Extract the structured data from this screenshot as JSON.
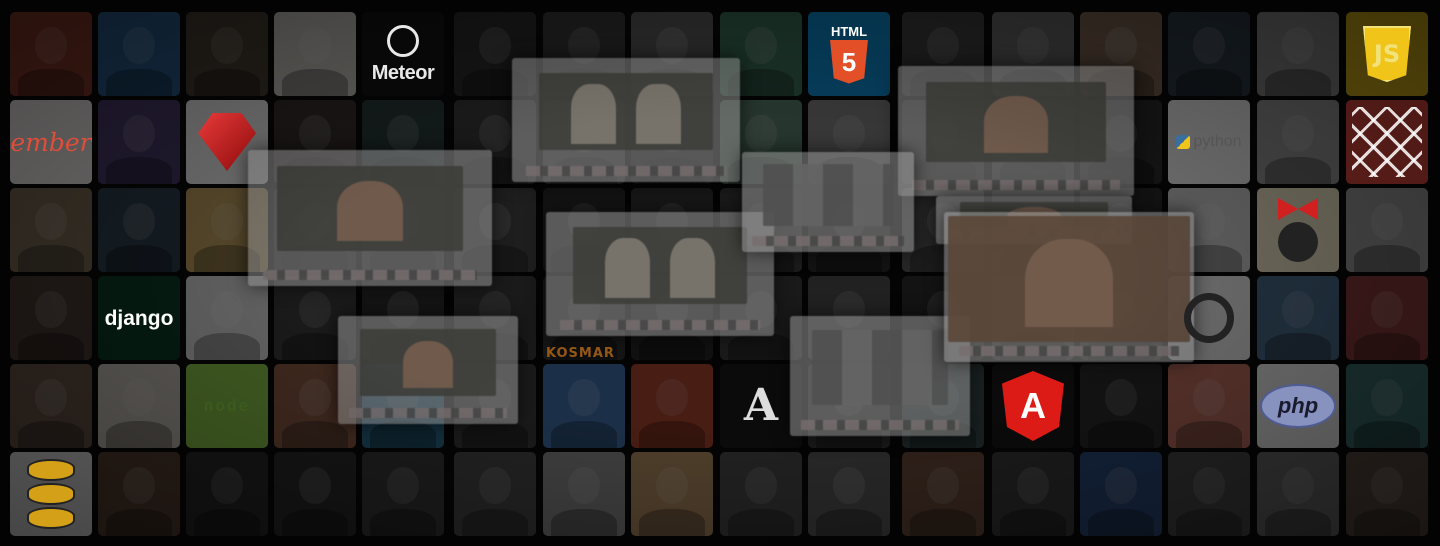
{
  "tiles": [
    {
      "r": 0,
      "c": 0,
      "type": "face",
      "bg": "#8a3a2a"
    },
    {
      "r": 0,
      "c": 1,
      "type": "face",
      "bg": "#2a5e8e"
    },
    {
      "r": 0,
      "c": 2,
      "type": "face",
      "bg": "#4a3e33"
    },
    {
      "r": 0,
      "c": 3,
      "type": "face",
      "bg": "#c9c7c2"
    },
    {
      "r": 0,
      "c": 4,
      "type": "logo",
      "bg": "#151515",
      "logo": "meteor",
      "label": "Meteor",
      "color": "#e8e8e8",
      "icon": "meteor-icon"
    },
    {
      "r": 0,
      "c": 5,
      "type": "face",
      "bg": "#2d2d2d"
    },
    {
      "r": 0,
      "c": 6,
      "type": "face",
      "bg": "#3a3a3a"
    },
    {
      "r": 0,
      "c": 7,
      "type": "face",
      "bg": "#5c5c5c"
    },
    {
      "r": 0,
      "c": 8,
      "type": "face",
      "bg": "#3b6d57"
    },
    {
      "r": 0,
      "c": 9,
      "type": "logo",
      "bg": "#0f87c9",
      "logo": "html5",
      "label": "HTML",
      "badge": "5",
      "color": "#e34f26",
      "icon": "html5-icon"
    },
    {
      "r": 0,
      "c": 10,
      "type": "face",
      "bg": "#3e3e3e"
    },
    {
      "r": 0,
      "c": 11,
      "type": "face",
      "bg": "#666666"
    },
    {
      "r": 0,
      "c": 12,
      "type": "face",
      "bg": "#7e6452"
    },
    {
      "r": 0,
      "c": 13,
      "type": "face",
      "bg": "#2f3d48"
    },
    {
      "r": 0,
      "c": 14,
      "type": "face",
      "bg": "#8a8a8a"
    },
    {
      "r": 0,
      "c": 15,
      "type": "logo",
      "bg": "#d9b31c",
      "logo": "js",
      "label": "JS",
      "color": "#f2e27a",
      "icon": "js-icon"
    },
    {
      "r": 1,
      "c": 0,
      "type": "logo",
      "bg": "#f4eeee",
      "logo": "ember",
      "label": "ember",
      "color": "#e04e39",
      "icon": "ember-icon"
    },
    {
      "r": 1,
      "c": 1,
      "type": "face",
      "bg": "#4b3a6b"
    },
    {
      "r": 1,
      "c": 2,
      "type": "logo",
      "bg": "#f1f1f1",
      "logo": "ruby",
      "label": "",
      "color": "#c61a1a",
      "icon": "ruby-icon"
    },
    {
      "r": 1,
      "c": 3,
      "type": "face",
      "bg": "#3a3030"
    },
    {
      "r": 1,
      "c": 4,
      "type": "face",
      "bg": "#2a3a3a"
    },
    {
      "r": 1,
      "c": 5,
      "type": "face",
      "bg": "#3b3b3b"
    },
    {
      "r": 1,
      "c": 6,
      "type": "face",
      "bg": "#444444"
    },
    {
      "r": 1,
      "c": 7,
      "type": "face",
      "bg": "#222222"
    },
    {
      "r": 1,
      "c": 8,
      "type": "face",
      "bg": "#557766"
    },
    {
      "r": 1,
      "c": 9,
      "type": "face",
      "bg": "#7a7a7a"
    },
    {
      "r": 1,
      "c": 10,
      "type": "face",
      "bg": "#333333"
    },
    {
      "r": 1,
      "c": 11,
      "type": "face",
      "bg": "#3d3d3d"
    },
    {
      "r": 1,
      "c": 12,
      "type": "face",
      "bg": "#2e2e2e"
    },
    {
      "r": 1,
      "c": 13,
      "type": "logo",
      "bg": "#f2f2f2",
      "logo": "python",
      "label": "python",
      "color": "#3a6e9e",
      "icon": "python-icon"
    },
    {
      "r": 1,
      "c": 14,
      "type": "face",
      "bg": "#9a9a9a"
    },
    {
      "r": 1,
      "c": 15,
      "type": "logo",
      "bg": "#e24a3f",
      "logo": "laravel",
      "label": "",
      "color": "#ffffff",
      "icon": "laravel-icon"
    },
    {
      "r": 2,
      "c": 0,
      "type": "face",
      "bg": "#7b6a55"
    },
    {
      "r": 2,
      "c": 1,
      "type": "face",
      "bg": "#2e3e4e"
    },
    {
      "r": 2,
      "c": 2,
      "type": "face",
      "bg": "#c0a060"
    },
    {
      "r": 2,
      "c": 3,
      "type": "face",
      "bg": "#2b2b2b"
    },
    {
      "r": 2,
      "c": 4,
      "type": "face",
      "bg": "#3a3a3a"
    },
    {
      "r": 2,
      "c": 5,
      "type": "face",
      "bg": "#444444"
    },
    {
      "r": 2,
      "c": 6,
      "type": "face",
      "bg": "#2a2a2a"
    },
    {
      "r": 2,
      "c": 7,
      "type": "face",
      "bg": "#333333"
    },
    {
      "r": 2,
      "c": 8,
      "type": "face",
      "bg": "#3c3c3c"
    },
    {
      "r": 2,
      "c": 9,
      "type": "face",
      "bg": "#2a2a2a"
    },
    {
      "r": 2,
      "c": 10,
      "type": "face",
      "bg": "#555555"
    },
    {
      "r": 2,
      "c": 11,
      "type": "face",
      "bg": "#3a3a3a"
    },
    {
      "r": 2,
      "c": 12,
      "type": "face",
      "bg": "#2e2e2e"
    },
    {
      "r": 2,
      "c": 13,
      "type": "face",
      "bg": "#cfcfcf"
    },
    {
      "r": 2,
      "c": 14,
      "type": "logo",
      "bg": "#f1e9c9",
      "logo": "kiki",
      "label": "",
      "color": "#d02020",
      "icon": "cartoon-girl-icon"
    },
    {
      "r": 2,
      "c": 15,
      "type": "face",
      "bg": "#9c9c9c"
    },
    {
      "r": 3,
      "c": 0,
      "type": "face",
      "bg": "#4a3a33"
    },
    {
      "r": 3,
      "c": 1,
      "type": "logo",
      "bg": "#0c3c26",
      "logo": "django",
      "label": "django",
      "color": "#ffffff",
      "icon": "django-icon"
    },
    {
      "r": 3,
      "c": 2,
      "type": "face",
      "bg": "#d8d8d8"
    },
    {
      "r": 3,
      "c": 3,
      "type": "face",
      "bg": "#3a3a3a"
    },
    {
      "r": 3,
      "c": 4,
      "type": "face",
      "bg": "#2e2e2e"
    },
    {
      "r": 3,
      "c": 5,
      "type": "face",
      "bg": "#3a3a3a"
    },
    {
      "r": 3,
      "c": 6,
      "type": "face",
      "bg": "#2f2f2f"
    },
    {
      "r": 3,
      "c": 7,
      "type": "face",
      "bg": "#262626"
    },
    {
      "r": 3,
      "c": 8,
      "type": "face",
      "bg": "#3a3a3a"
    },
    {
      "r": 3,
      "c": 9,
      "type": "face",
      "bg": "#4a4a4a"
    },
    {
      "r": 3,
      "c": 10,
      "type": "face",
      "bg": "#2a2a2a"
    },
    {
      "r": 3,
      "c": 11,
      "type": "face",
      "bg": "#3c3c3c"
    },
    {
      "r": 3,
      "c": 12,
      "type": "face",
      "bg": "#2f2f2f"
    },
    {
      "r": 3,
      "c": 13,
      "type": "logo",
      "bg": "#eeeeee",
      "logo": "periscope",
      "label": "",
      "color": "#222222",
      "icon": "periscope-icon"
    },
    {
      "r": 3,
      "c": 14,
      "type": "face",
      "bg": "#4a6a8a"
    },
    {
      "r": 3,
      "c": 15,
      "type": "face",
      "bg": "#8a3a3a"
    },
    {
      "r": 4,
      "c": 0,
      "type": "face",
      "bg": "#6a5548"
    },
    {
      "r": 4,
      "c": 1,
      "type": "face",
      "bg": "#c8c0b8"
    },
    {
      "r": 4,
      "c": 2,
      "type": "logo",
      "bg": "#8cc84b",
      "logo": "node",
      "label": "node",
      "color": "#3c5a1e",
      "icon": "nodejs-icon"
    },
    {
      "r": 4,
      "c": 3,
      "type": "face",
      "bg": "#8a5a44"
    },
    {
      "r": 4,
      "c": 4,
      "type": "face",
      "bg": "#2a6a8a"
    },
    {
      "r": 4,
      "c": 5,
      "type": "face",
      "bg": "#3a3a3a"
    },
    {
      "r": 4,
      "c": 6,
      "type": "face",
      "bg": "#3c6aa0"
    },
    {
      "r": 4,
      "c": 7,
      "type": "face",
      "bg": "#a0402a"
    },
    {
      "r": 4,
      "c": 8,
      "type": "logo",
      "bg": "#1a1a1a",
      "logo": "letter-a",
      "label": "A",
      "color": "#dddddd",
      "icon": "letter-a-icon"
    },
    {
      "r": 4,
      "c": 9,
      "type": "face",
      "bg": "#3a3a3a"
    },
    {
      "r": 4,
      "c": 10,
      "type": "face",
      "bg": "#3a4a4a"
    },
    {
      "r": 4,
      "c": 11,
      "type": "logo",
      "bg": "#1a1a1a",
      "logo": "angular",
      "label": "A",
      "color": "#dd1b16",
      "icon": "angular-icon"
    },
    {
      "r": 4,
      "c": 12,
      "type": "face",
      "bg": "#2a2a2a"
    },
    {
      "r": 4,
      "c": 13,
      "type": "face",
      "bg": "#c07060"
    },
    {
      "r": 4,
      "c": 14,
      "type": "logo",
      "bg": "#f2f2f2",
      "logo": "php",
      "label": "php",
      "color": "#4f5b93",
      "icon": "php-icon"
    },
    {
      "r": 4,
      "c": 15,
      "type": "face",
      "bg": "#3a6a6a"
    },
    {
      "r": 5,
      "c": 0,
      "type": "logo",
      "bg": "#e9e9e9",
      "logo": "database",
      "label": "",
      "color": "#d4a017",
      "icon": "database-icon"
    },
    {
      "r": 5,
      "c": 1,
      "type": "face",
      "bg": "#5a4233"
    },
    {
      "r": 5,
      "c": 2,
      "type": "face",
      "bg": "#2a2a2a"
    },
    {
      "r": 5,
      "c": 3,
      "type": "face",
      "bg": "#2e2e2e"
    },
    {
      "r": 5,
      "c": 4,
      "type": "face",
      "bg": "#3a3a3a"
    },
    {
      "r": 5,
      "c": 5,
      "type": "face",
      "bg": "#4a4a4a"
    },
    {
      "r": 5,
      "c": 6,
      "type": "face",
      "bg": "#8a8a8a"
    },
    {
      "r": 5,
      "c": 7,
      "type": "face",
      "bg": "#b08a60"
    },
    {
      "r": 5,
      "c": 8,
      "type": "face",
      "bg": "#4a4a4a"
    },
    {
      "r": 5,
      "c": 9,
      "type": "face",
      "bg": "#5a5a5a"
    },
    {
      "r": 5,
      "c": 10,
      "type": "face",
      "bg": "#6a4a3a"
    },
    {
      "r": 5,
      "c": 11,
      "type": "face",
      "bg": "#3a3a3a"
    },
    {
      "r": 5,
      "c": 12,
      "type": "face",
      "bg": "#2a4a7a"
    },
    {
      "r": 5,
      "c": 13,
      "type": "face",
      "bg": "#4a4a4a"
    },
    {
      "r": 5,
      "c": 14,
      "type": "face",
      "bg": "#6a6a6a"
    },
    {
      "r": 5,
      "c": 15,
      "type": "face",
      "bg": "#5a4a40"
    }
  ],
  "overlays": [
    {
      "name": "video-call-screenshot-1",
      "kind": "two-people"
    },
    {
      "name": "video-call-screenshot-2",
      "kind": "one-person"
    },
    {
      "name": "video-call-screenshot-3",
      "kind": "one-person"
    },
    {
      "name": "video-call-screenshot-4",
      "kind": "two-people"
    },
    {
      "name": "video-call-screenshot-5",
      "kind": "grid"
    },
    {
      "name": "video-call-screenshot-6",
      "kind": "one-person"
    },
    {
      "name": "video-call-screenshot-7",
      "kind": "one-person"
    },
    {
      "name": "video-call-screenshot-8",
      "kind": "grid"
    },
    {
      "name": "video-call-screenshot-9",
      "kind": "hands"
    }
  ],
  "overlay_text": {
    "kosmar_label": "KOSMAR"
  },
  "colors": {
    "dim_overlay": "#000000",
    "background": "#0b0b0b"
  }
}
